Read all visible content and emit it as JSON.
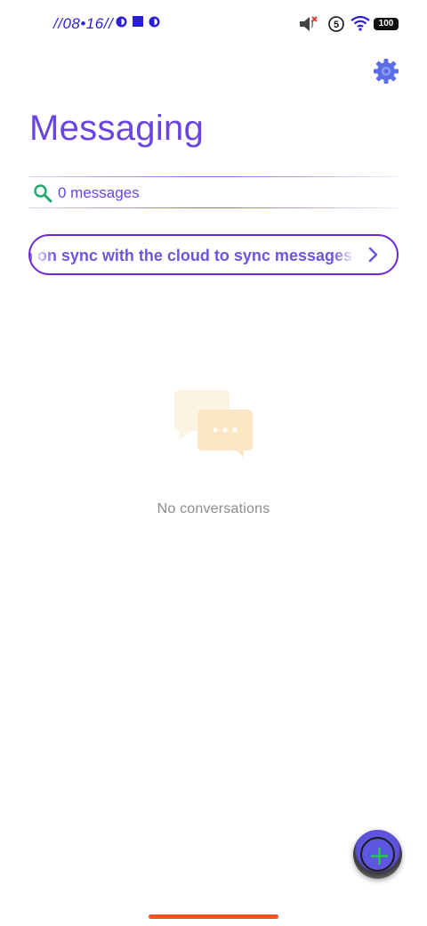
{
  "status_bar": {
    "time": "//08•16//",
    "battery": "100",
    "sim_badge": "5",
    "icons": [
      "circle-half-icon",
      "square-icon",
      "circle-half-icon",
      "muted-speaker-icon",
      "sim-5-icon",
      "wifi-icon",
      "battery-icon"
    ]
  },
  "header": {
    "title": "Messaging",
    "settings_icon": "gear-icon"
  },
  "search": {
    "label": "0 messages",
    "icon": "search-icon"
  },
  "sync_banner": {
    "text": "Turn on sync with the cloud to sync messages",
    "icon": "chevron-right-icon"
  },
  "empty_state": {
    "text": "No conversations",
    "illustration": "chat-bubbles-icon"
  },
  "fab": {
    "icon": "plus-icon"
  },
  "colors": {
    "accent": "#6a45e0",
    "search_icon": "#20a870",
    "banner_border": "#6f2bd3",
    "fab": "#5e55e0",
    "fab_plus": "#22cc44",
    "home_indicator": "#f4511e",
    "empty_text": "#8c8c8c"
  }
}
